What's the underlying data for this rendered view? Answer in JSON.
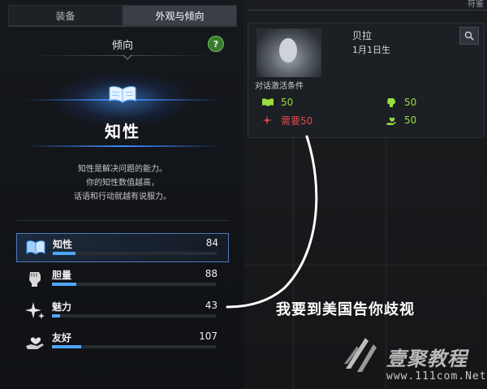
{
  "tabs": [
    {
      "label": "装备",
      "active": false
    },
    {
      "label": "外观与倾向",
      "active": true
    }
  ],
  "panel_title": "倾向",
  "help_icon_text": "?",
  "hero": {
    "icon": "open-book-icon",
    "name": "知性",
    "desc_lines": [
      "知性是解决问题的能力。",
      "你的知性数值越高，",
      "话语和行动就越有说服力。"
    ]
  },
  "stats": [
    {
      "name": "知性",
      "value": "84",
      "fill": 0.14,
      "icon": "book-icon",
      "selected": true
    },
    {
      "name": "胆量",
      "value": "88",
      "fill": 0.15,
      "icon": "fist-icon",
      "selected": false
    },
    {
      "name": "魅力",
      "value": "43",
      "fill": 0.05,
      "icon": "sparkle-icon",
      "selected": false
    },
    {
      "name": "友好",
      "value": "107",
      "fill": 0.18,
      "icon": "heart-hand-icon",
      "selected": false
    }
  ],
  "character": {
    "name": "贝拉",
    "birthday": "1月1日生",
    "conditions_label": "对话激活条件",
    "conditions": [
      {
        "icon": "book-icon",
        "text": "50",
        "color": "#9bdc3f"
      },
      {
        "icon": "fist-icon",
        "text": "50",
        "color": "#9bdc3f"
      },
      {
        "icon": "sparkle-icon",
        "text": "需要50",
        "color": "#e5484d"
      },
      {
        "icon": "heart-hand-icon",
        "text": "50",
        "color": "#9bdc3f"
      }
    ]
  },
  "top_right_text": "符鉴",
  "annotation": "我要到美国告你歧视",
  "watermark": {
    "name": "壹聚教程",
    "url": "www.111com.Net"
  },
  "colors": {
    "accent_blue": "#4fa6ff",
    "req_ok": "#9bdc3f",
    "req_fail": "#e5484d"
  }
}
